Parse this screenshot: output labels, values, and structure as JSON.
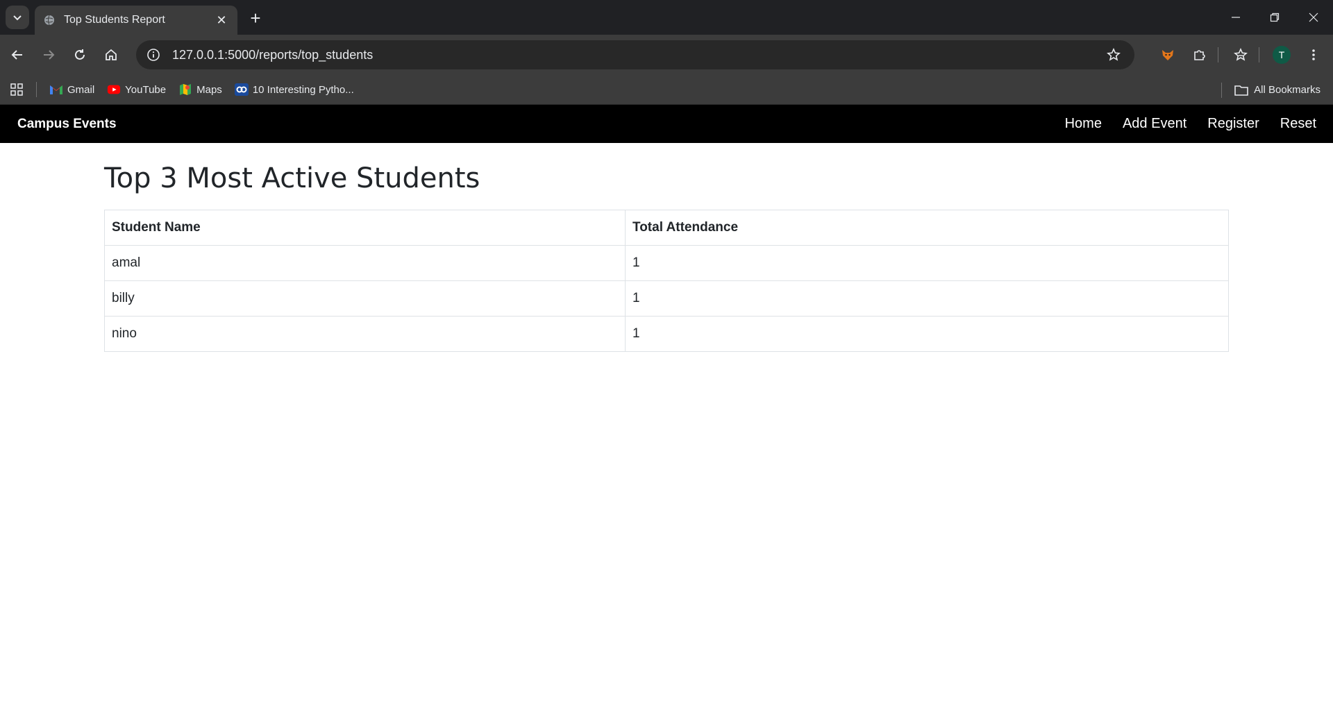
{
  "browser": {
    "tab_title": "Top Students Report",
    "url": "127.0.0.1:5000/reports/top_students",
    "profile_initial": "T",
    "bookmarks": [
      {
        "label": "Gmail",
        "icon": "gmail-icon"
      },
      {
        "label": "YouTube",
        "icon": "youtube-icon"
      },
      {
        "label": "Maps",
        "icon": "maps-icon"
      },
      {
        "label": "10 Interesting Pytho...",
        "icon": "link-icon"
      }
    ],
    "all_bookmarks_label": "All Bookmarks"
  },
  "site": {
    "brand": "Campus Events",
    "nav": [
      "Home",
      "Add Event",
      "Register",
      "Reset"
    ]
  },
  "page": {
    "heading": "Top 3 Most Active Students",
    "table": {
      "headers": [
        "Student Name",
        "Total Attendance"
      ],
      "rows": [
        [
          "amal",
          "1"
        ],
        [
          "billy",
          "1"
        ],
        [
          "nino",
          "1"
        ]
      ]
    }
  },
  "colors": {
    "navbar_bg": "#000000",
    "text": "#212529",
    "border": "#dee2e6",
    "chrome_bg": "#202124",
    "toolbar_bg": "#3c3c3c"
  }
}
